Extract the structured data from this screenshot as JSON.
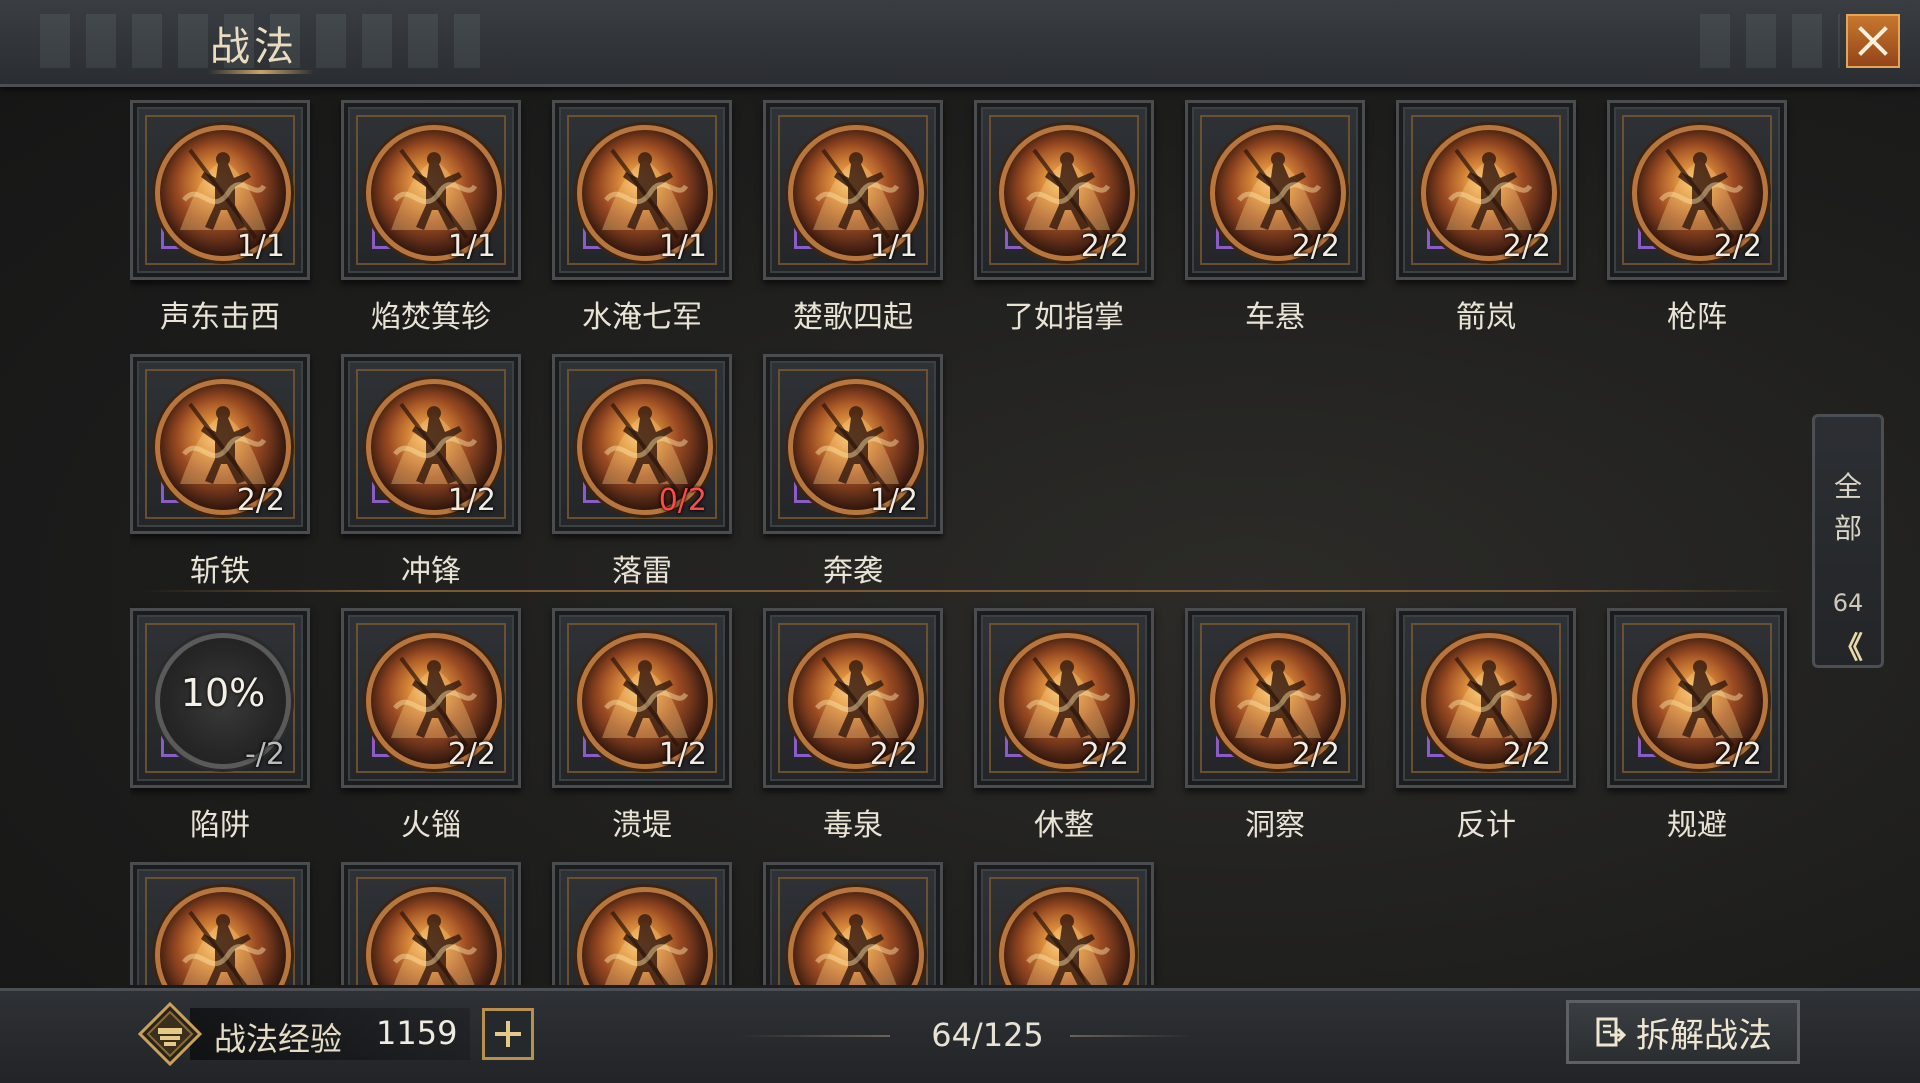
{
  "header": {
    "title": "战法"
  },
  "skills": [
    {
      "name": "声东击西",
      "have": "1",
      "total": "1",
      "state": "owned"
    },
    {
      "name": "焰焚箕轸",
      "have": "1",
      "total": "1",
      "state": "owned"
    },
    {
      "name": "水淹七军",
      "have": "1",
      "total": "1",
      "state": "owned"
    },
    {
      "name": "楚歌四起",
      "have": "1",
      "total": "1",
      "state": "owned"
    },
    {
      "name": "了如指掌",
      "have": "2",
      "total": "2",
      "state": "owned"
    },
    {
      "name": "车悬",
      "have": "2",
      "total": "2",
      "state": "owned"
    },
    {
      "name": "箭岚",
      "have": "2",
      "total": "2",
      "state": "owned"
    },
    {
      "name": "枪阵",
      "have": "2",
      "total": "2",
      "state": "owned"
    },
    {
      "name": "斩铁",
      "have": "2",
      "total": "2",
      "state": "owned"
    },
    {
      "name": "冲锋",
      "have": "1",
      "total": "2",
      "state": "owned"
    },
    {
      "name": "落雷",
      "have": "0",
      "total": "2",
      "state": "empty"
    },
    {
      "name": "奔袭",
      "have": "1",
      "total": "2",
      "state": "owned"
    },
    {
      "name": "陷阱",
      "have": "-",
      "total": "2",
      "state": "locked",
      "progress": "10%"
    },
    {
      "name": "火锱",
      "have": "2",
      "total": "2",
      "state": "owned"
    },
    {
      "name": "溃堤",
      "have": "1",
      "total": "2",
      "state": "owned"
    },
    {
      "name": "毒泉",
      "have": "2",
      "total": "2",
      "state": "owned"
    },
    {
      "name": "休整",
      "have": "2",
      "total": "2",
      "state": "owned"
    },
    {
      "name": "洞察",
      "have": "2",
      "total": "2",
      "state": "owned"
    },
    {
      "name": "反计",
      "have": "2",
      "total": "2",
      "state": "owned"
    },
    {
      "name": "规避",
      "have": "2",
      "total": "2",
      "state": "owned"
    },
    {
      "name": "",
      "have": "",
      "total": "",
      "state": "owned"
    },
    {
      "name": "",
      "have": "",
      "total": "",
      "state": "owned"
    },
    {
      "name": "",
      "have": "",
      "total": "",
      "state": "owned"
    },
    {
      "name": "",
      "have": "",
      "total": "",
      "state": "owned"
    },
    {
      "name": "",
      "have": "",
      "total": "",
      "state": "owned"
    }
  ],
  "side_filter": {
    "label_line1": "全",
    "label_line2": "部",
    "count": "64",
    "chevron": "《"
  },
  "footer": {
    "exp_label": "战法经验",
    "exp_value": "1159",
    "capacity": "64/125",
    "disassemble_label": "拆解战法"
  },
  "icons": [
    "close-icon",
    "plus-icon",
    "scroll-up-icon",
    "scroll-down-icon",
    "chevron-left-icon",
    "exp-badge-icon",
    "disassemble-icon"
  ],
  "colors": {
    "accent_orange": "#c8772d",
    "count_red": "#ff4a4a",
    "gold": "#b7904e"
  }
}
